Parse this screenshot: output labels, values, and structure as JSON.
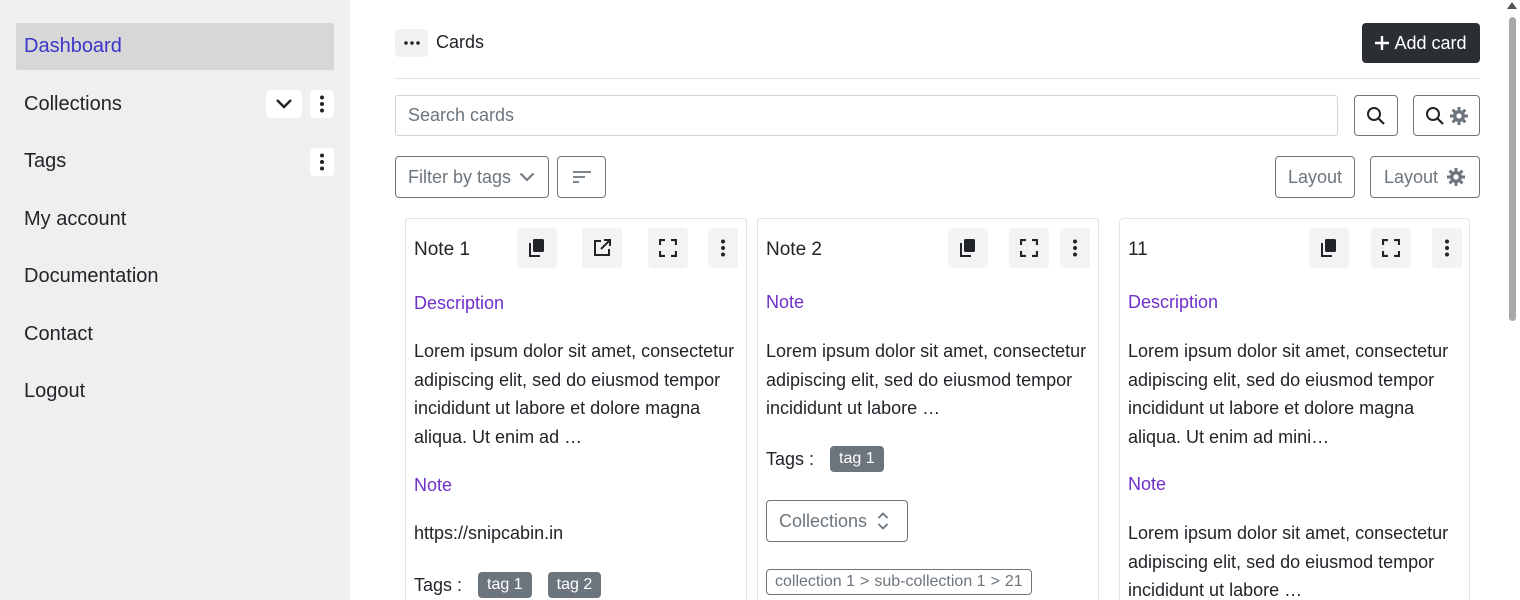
{
  "sidebar": {
    "items": [
      {
        "label": "Dashboard",
        "active": true
      },
      {
        "label": "Collections"
      },
      {
        "label": "Tags"
      },
      {
        "label": "My account"
      },
      {
        "label": "Documentation"
      },
      {
        "label": "Contact"
      },
      {
        "label": "Logout"
      }
    ]
  },
  "header": {
    "title": "Cards",
    "add_label": "Add card"
  },
  "search": {
    "placeholder": "Search cards"
  },
  "toolbar": {
    "filter_label": "Filter by tags",
    "layout_label": "Layout",
    "layout_settings_label": "Layout"
  },
  "cards": [
    {
      "title": "Note 1",
      "sections": [
        {
          "label": "Description",
          "text": "Lorem ipsum dolor sit amet, consectetur adipiscing elit, sed do eiusmod tempor incididunt ut labore et dolore magna aliqua. Ut enim ad …"
        },
        {
          "label": "Note",
          "text": "https://snipcabin.in"
        }
      ],
      "tags_label": "Tags :",
      "tags": [
        "tag 1",
        "tag 2"
      ]
    },
    {
      "title": "Note 2",
      "sections": [
        {
          "label": "Note",
          "text": "Lorem ipsum dolor sit amet, consectetur adipiscing elit, sed do eiusmod tempor incididunt ut labore …"
        }
      ],
      "tags_label": "Tags :",
      "tags": [
        "tag 1"
      ],
      "collections_label": "Collections",
      "breadcrumb": [
        "collection 1",
        "sub-collection 1",
        "21"
      ]
    },
    {
      "title": "11",
      "sections": [
        {
          "label": "Description",
          "text": "Lorem ipsum dolor sit amet, consectetur adipiscing elit, sed do eiusmod tempor incididunt ut labore et dolore magna aliqua. Ut enim ad mini…"
        },
        {
          "label": "Note",
          "text": "Lorem ipsum dolor sit amet, consectetur adipiscing elit, sed do eiusmod tempor incididunt ut labore …"
        }
      ]
    }
  ],
  "icons": {
    "more": "more-horizontal-icon",
    "plus": "plus-icon",
    "search": "search-icon",
    "search_settings": "search-settings-icon",
    "chevron": "chevron-down-icon",
    "sort": "sort-icon",
    "gear": "gear-icon",
    "copy": "copy-icon",
    "open": "external-link-icon",
    "fullscreen": "fullscreen-icon",
    "kebab": "more-vertical-icon"
  },
  "colors": {
    "accent": "#3b35c8",
    "section_label": "#6f2fc9",
    "primary_button": "#2b2f33",
    "tag_bg": "#6c757d"
  }
}
